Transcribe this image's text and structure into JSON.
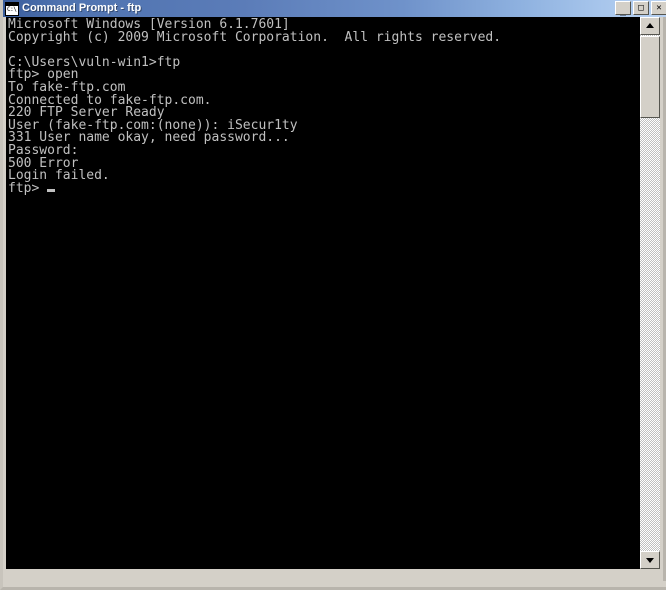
{
  "window": {
    "title": "Command Prompt - ftp",
    "icon": "command-prompt-icon",
    "title_bar_color_left": "#3a5d9c",
    "title_bar_color_right": "#b9d2f2",
    "frame_color": "#d4d0c8"
  },
  "window_buttons": {
    "minimize": "_",
    "maximize": "□",
    "close": "✕"
  },
  "console": {
    "background": "#000000",
    "foreground": "#c0c0c0",
    "lines": [
      "Microsoft Windows [Version 6.1.7601]",
      "Copyright (c) 2009 Microsoft Corporation.  All rights reserved.",
      "",
      "C:\\Users\\vuln-win1>ftp",
      "ftp> open",
      "To fake-ftp.com",
      "Connected to fake-ftp.com.",
      "220 FTP Server Ready",
      "User (fake-ftp.com:(none)): iSecur1ty",
      "331 User name okay, need password...",
      "Password:",
      "500 Error",
      "Login failed.",
      "ftp> "
    ],
    "cursor": "block-underscore-cursor"
  },
  "scrollbar": {
    "up_arrow": "scroll-up-arrow",
    "down_arrow": "scroll-down-arrow",
    "thumb": "scroll-thumb"
  }
}
